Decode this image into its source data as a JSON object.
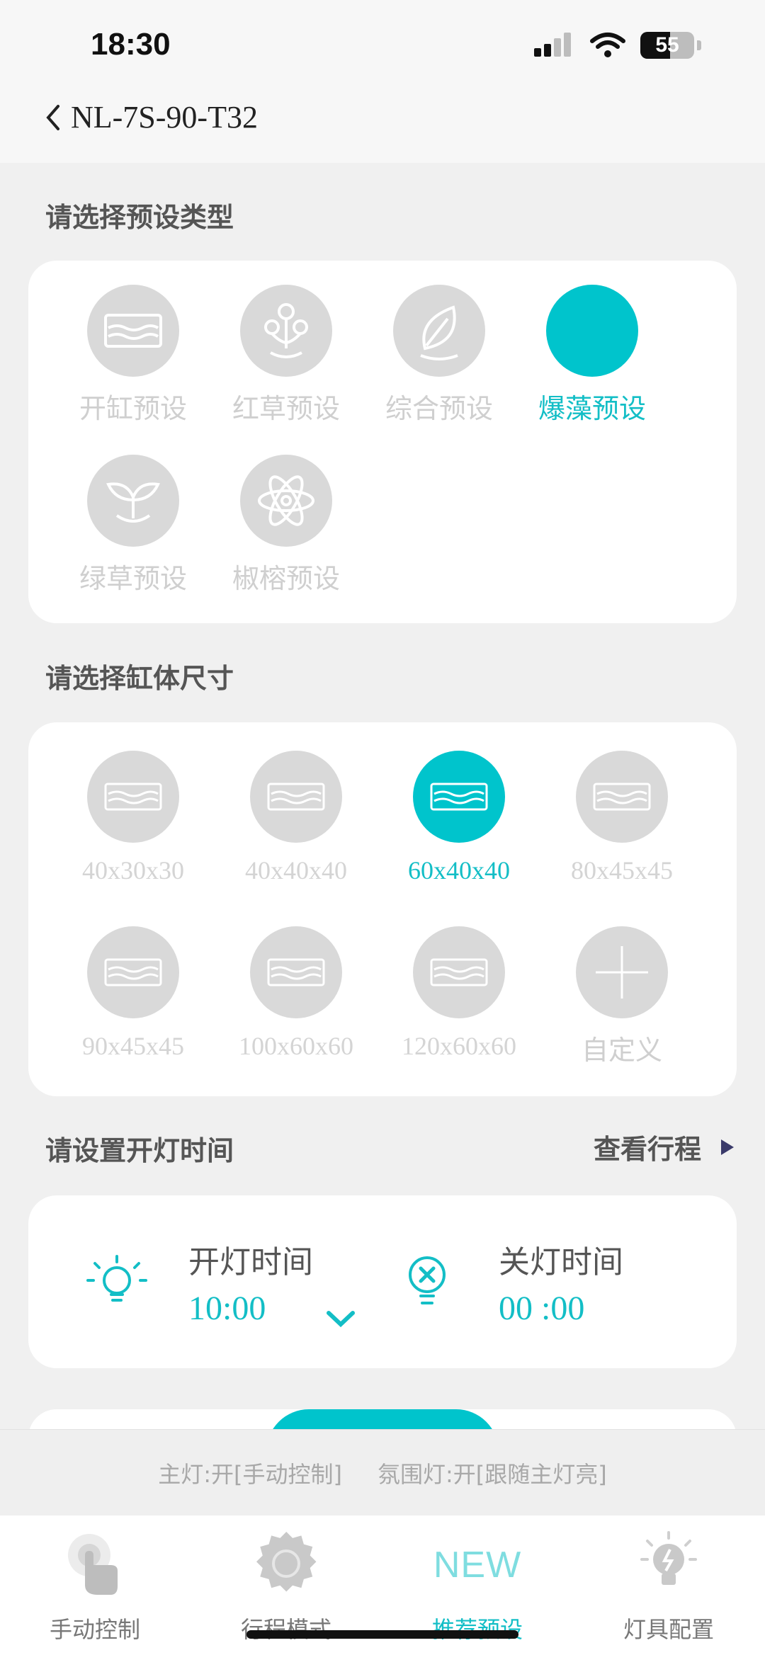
{
  "status_bar": {
    "time": "18:30",
    "battery": "55",
    "battery_level": 0.55
  },
  "nav": {
    "title": "NL-7S-90-T32"
  },
  "preset_type": {
    "title": "请选择预设类型",
    "options": [
      {
        "label": "开缸预设",
        "icon": "tank-icon",
        "selected": false
      },
      {
        "label": "红草预设",
        "icon": "flower-icon",
        "selected": false
      },
      {
        "label": "综合预设",
        "icon": "leaf-icon",
        "selected": false
      },
      {
        "label": "爆藻预设",
        "icon": "algae-icon",
        "selected": true
      },
      {
        "label": "绿草预设",
        "icon": "sprout-icon",
        "selected": false
      },
      {
        "label": "椒榕预设",
        "icon": "atom-icon",
        "selected": false
      }
    ]
  },
  "tank_size": {
    "title": "请选择缸体尺寸",
    "options": [
      {
        "label": "40x30x30",
        "selected": false
      },
      {
        "label": "40x40x40",
        "selected": false
      },
      {
        "label": "60x40x40",
        "selected": true
      },
      {
        "label": "80x45x45",
        "selected": false
      },
      {
        "label": "90x45x45",
        "selected": false
      },
      {
        "label": "100x60x60",
        "selected": false
      },
      {
        "label": "120x60x60",
        "selected": false
      },
      {
        "label": "自定义",
        "selected": false
      }
    ]
  },
  "light_time": {
    "title": "请设置开灯时间",
    "view_schedule": "查看行程",
    "on_label": "开灯时间",
    "on_value": "10:00",
    "off_label": "关灯时间",
    "off_value": "00 :00"
  },
  "status_strip": {
    "main_light": "主灯:开[手动控制]",
    "ambient_light": "氛围灯:开[跟随主灯亮]"
  },
  "tabs": [
    {
      "label": "手动控制",
      "icon": "touch-icon",
      "active": false
    },
    {
      "label": "行程模式",
      "icon": "gear-icon",
      "active": false
    },
    {
      "label": "推荐预设",
      "icon_text": "NEW",
      "active": true
    },
    {
      "label": "灯具配置",
      "icon": "bulb-icon",
      "active": false
    }
  ],
  "colors": {
    "accent": "#00c4cc",
    "inactive": "#d9d9d9",
    "text_muted": "#cfcfcf"
  }
}
